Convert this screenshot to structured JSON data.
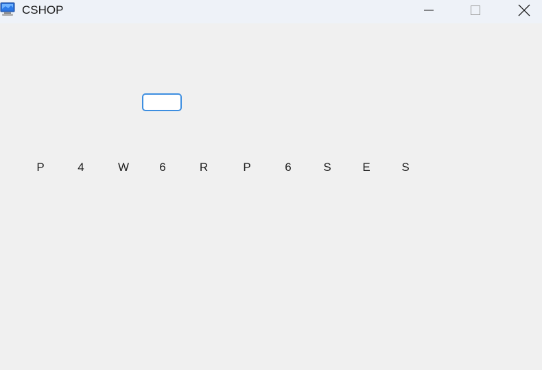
{
  "window": {
    "title": "CSHOP",
    "icon": "monitor-app-icon",
    "controls": [
      "minimize",
      "maximize",
      "close"
    ]
  },
  "input": {
    "value": ""
  },
  "letters": [
    "P",
    "4",
    "W",
    "6",
    "R",
    "P",
    "6",
    "S",
    "E",
    "S"
  ],
  "colors": {
    "background": "#f0f0f0",
    "titlebar": "#eef2f8",
    "input_border": "#3d8ee0"
  }
}
